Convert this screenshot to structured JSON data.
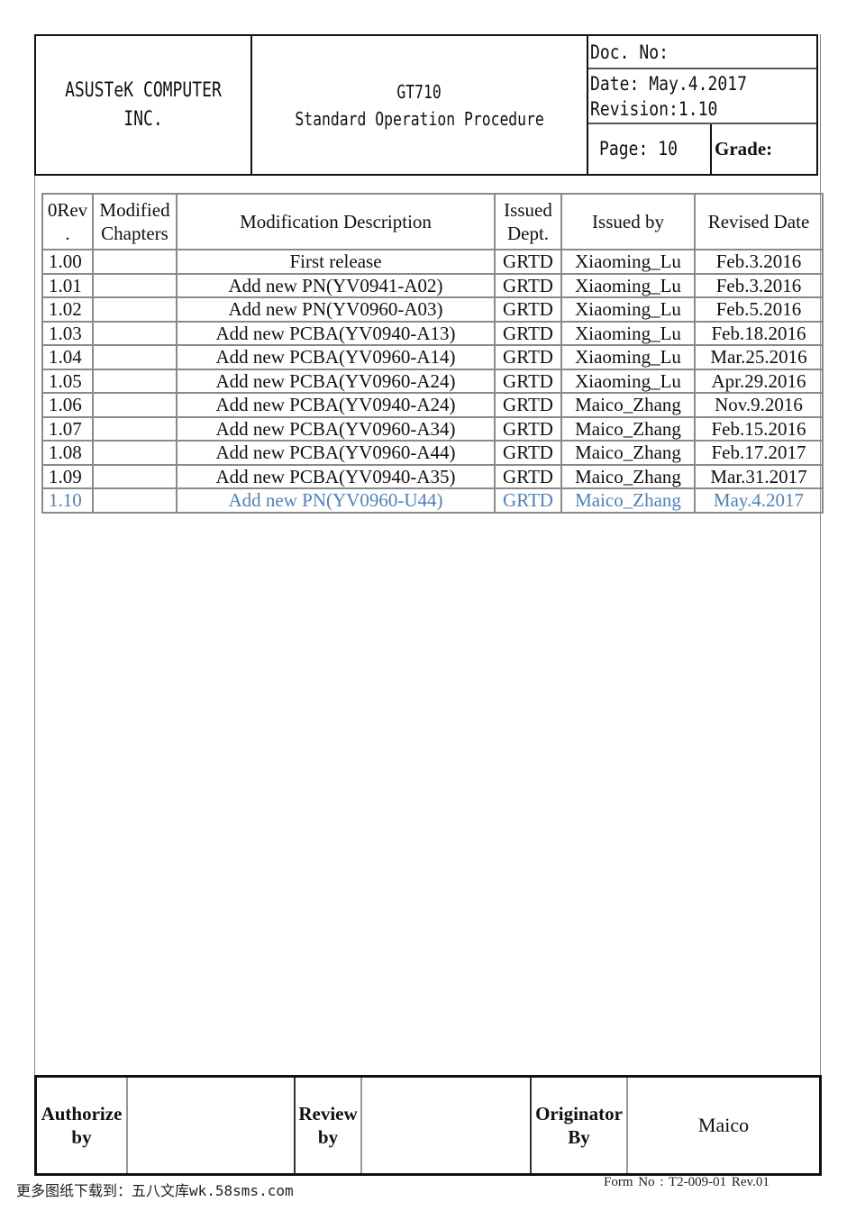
{
  "header": {
    "company_line1": "ASUSTeK COMPUTER",
    "company_line2": "INC.",
    "product": "GT710",
    "doc_title": "Standard Operation Procedure",
    "doc_no": "Doc. No:",
    "date": "Date: May.4.2017",
    "revision": "Revision:1.10",
    "page": "Page: 10",
    "grade": "Grade:"
  },
  "revision_table": {
    "columns": [
      {
        "line1": "0Rev",
        "line2": "."
      },
      {
        "line1": "Modified",
        "line2": "Chapters"
      },
      {
        "line1": "Modification Description",
        "line2": ""
      },
      {
        "line1": "Issued",
        "line2": "Dept."
      },
      {
        "line1": "Issued by",
        "line2": ""
      },
      {
        "line1": "Revised Date",
        "line2": ""
      }
    ],
    "rows": [
      {
        "rev": "1.00",
        "chapters": "",
        "description": "First release",
        "dept": "GRTD",
        "issued_by": "Xiaoming_Lu",
        "date": "Feb.3.2016"
      },
      {
        "rev": "1.01",
        "chapters": "",
        "description": "Add new PN(YV0941-A02)",
        "dept": "GRTD",
        "issued_by": "Xiaoming_Lu",
        "date": "Feb.3.2016"
      },
      {
        "rev": "1.02",
        "chapters": "",
        "description": "Add new PN(YV0960-A03)",
        "dept": "GRTD",
        "issued_by": "Xiaoming_Lu",
        "date": "Feb.5.2016"
      },
      {
        "rev": "1.03",
        "chapters": "",
        "description": "Add new PCBA(YV0940-A13)",
        "dept": "GRTD",
        "issued_by": "Xiaoming_Lu",
        "date": "Feb.18.2016"
      },
      {
        "rev": "1.04",
        "chapters": "",
        "description": "Add new PCBA(YV0960-A14)",
        "dept": "GRTD",
        "issued_by": "Xiaoming_Lu",
        "date": "Mar.25.2016"
      },
      {
        "rev": "1.05",
        "chapters": "",
        "description": "Add new PCBA(YV0960-A24)",
        "dept": "GRTD",
        "issued_by": "Xiaoming_Lu",
        "date": "Apr.29.2016"
      },
      {
        "rev": "1.06",
        "chapters": "",
        "description": "Add new PCBA(YV0940-A24)",
        "dept": "GRTD",
        "issued_by": "Maico_Zhang",
        "date": "Nov.9.2016"
      },
      {
        "rev": "1.07",
        "chapters": "",
        "description": "Add new PCBA(YV0960-A34)",
        "dept": "GRTD",
        "issued_by": "Maico_Zhang",
        "date": "Feb.15.2016"
      },
      {
        "rev": "1.08",
        "chapters": "",
        "description": "Add new PCBA(YV0960-A44)",
        "dept": "GRTD",
        "issued_by": "Maico_Zhang",
        "date": "Feb.17.2017"
      },
      {
        "rev": "1.09",
        "chapters": "",
        "description": "Add new PCBA(YV0940-A35)",
        "dept": "GRTD",
        "issued_by": "Maico_Zhang",
        "date": "Mar.31.2017"
      },
      {
        "rev": "1.10",
        "chapters": "",
        "description": "Add new PN(YV0960-U44)",
        "dept": "GRTD",
        "issued_by": "Maico_Zhang",
        "date": "May.4.2017",
        "current": true
      }
    ],
    "current_row_color": "#4f81bd"
  },
  "signatures": {
    "authorize_line1": "Authorize",
    "authorize_line2": "by",
    "authorize_value": "",
    "review_line1": "Review",
    "review_line2": "by",
    "review_value": "",
    "originator_line1": "Originator",
    "originator_line2": "By",
    "originator_value": "Maico"
  },
  "footer": {
    "download_note": "更多图纸下载到：五八文库wk.58sms.com",
    "form_no": "Form No : T2-009-01 Rev.01"
  }
}
